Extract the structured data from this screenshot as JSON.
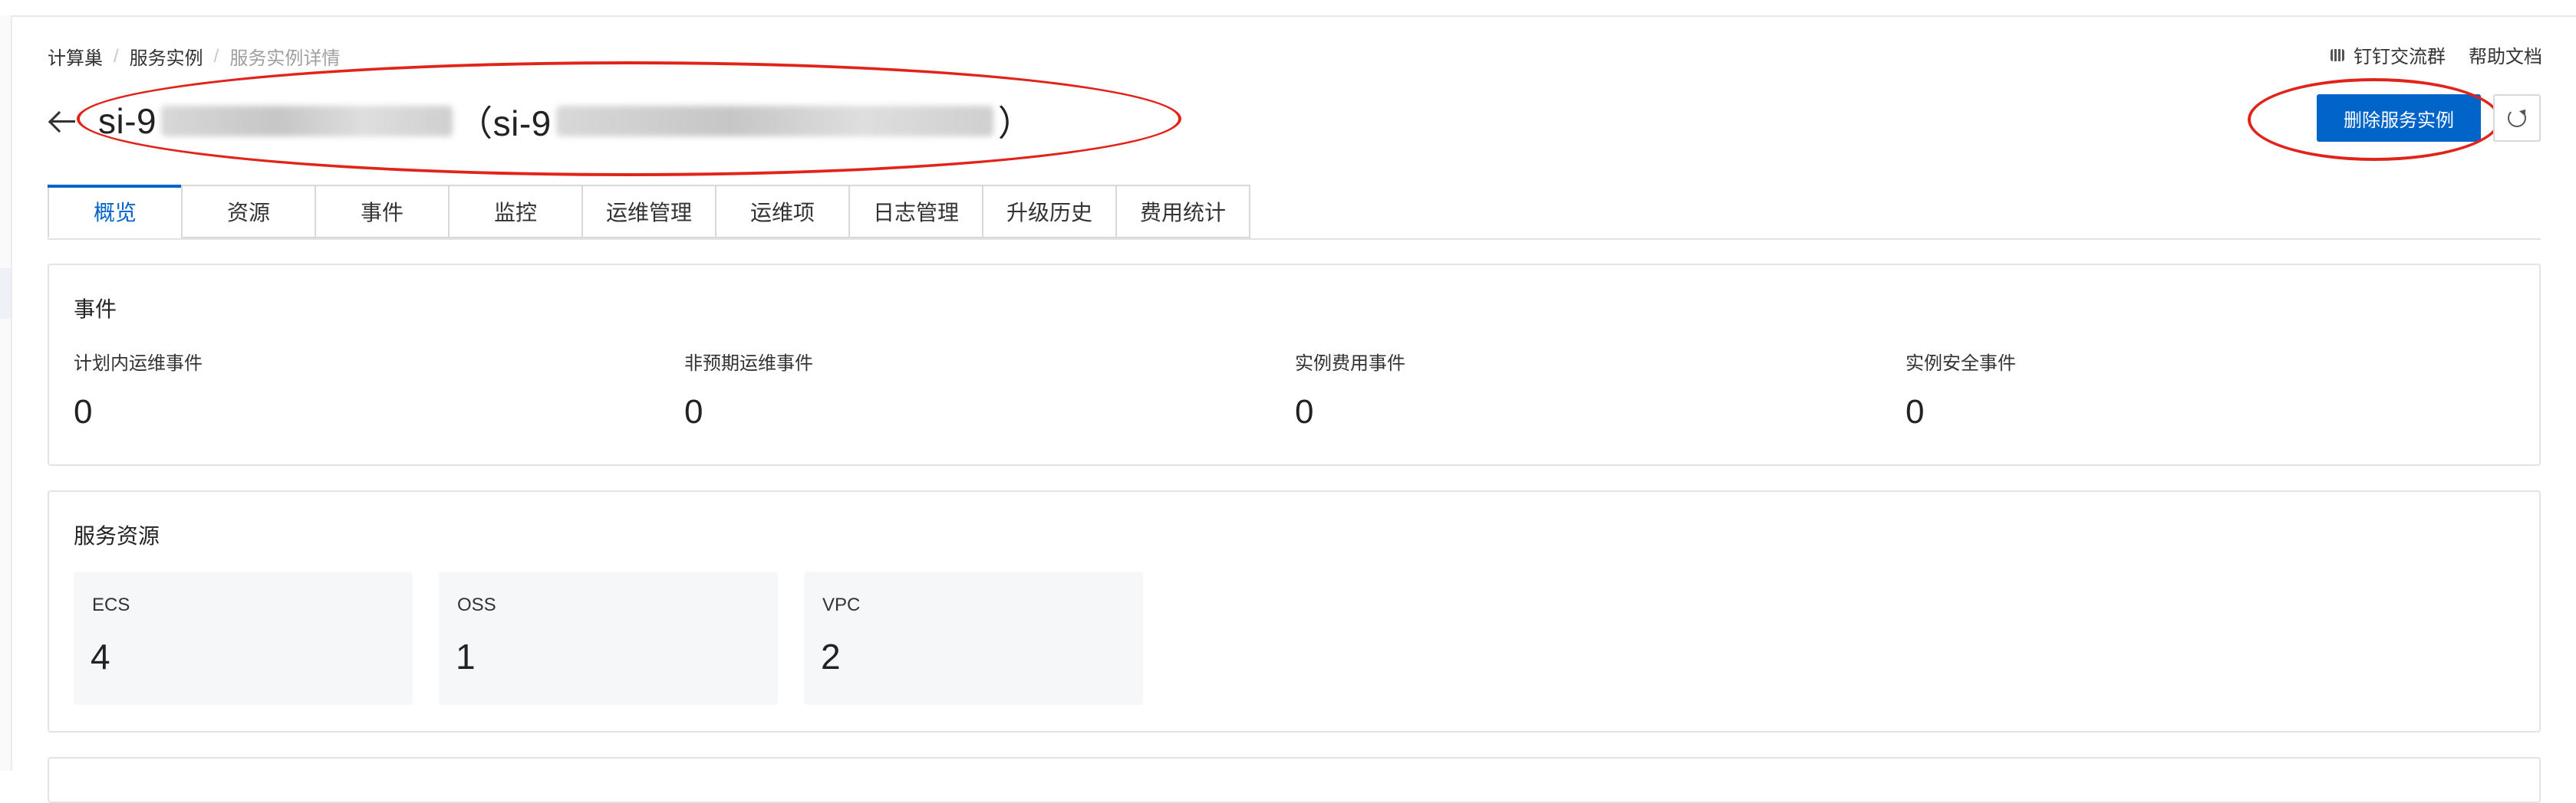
{
  "breadcrumb": {
    "items": [
      "计算巢",
      "服务实例",
      "服务实例详情"
    ],
    "separator": "/"
  },
  "header_links": {
    "dingtalk_group": "钉钉交流群",
    "help_docs": "帮助文档"
  },
  "title": {
    "prefix": "si-9",
    "middle": "（si-9",
    "suffix": "）",
    "note": "instance id partially obscured"
  },
  "actions": {
    "delete_label": "删除服务实例",
    "refresh_icon": "refresh-icon",
    "back_icon": "arrow-left-icon"
  },
  "tabs": [
    {
      "label": "概览",
      "active": true
    },
    {
      "label": "资源",
      "active": false
    },
    {
      "label": "事件",
      "active": false
    },
    {
      "label": "监控",
      "active": false
    },
    {
      "label": "运维管理",
      "active": false
    },
    {
      "label": "运维项",
      "active": false
    },
    {
      "label": "日志管理",
      "active": false
    },
    {
      "label": "升级历史",
      "active": false
    },
    {
      "label": "费用统计",
      "active": false
    }
  ],
  "events": {
    "title": "事件",
    "items": [
      {
        "label": "计划内运维事件",
        "value": "0"
      },
      {
        "label": "非预期运维事件",
        "value": "0"
      },
      {
        "label": "实例费用事件",
        "value": "0"
      },
      {
        "label": "实例安全事件",
        "value": "0"
      }
    ]
  },
  "resources": {
    "title": "服务资源",
    "items": [
      {
        "label": "ECS",
        "value": "4"
      },
      {
        "label": "OSS",
        "value": "1"
      },
      {
        "label": "VPC",
        "value": "2"
      }
    ]
  },
  "colors": {
    "primary": "#0064c8",
    "annotation": "#e2231a",
    "border": "#e3e3e3",
    "tile_bg": "#f6f7f9"
  }
}
